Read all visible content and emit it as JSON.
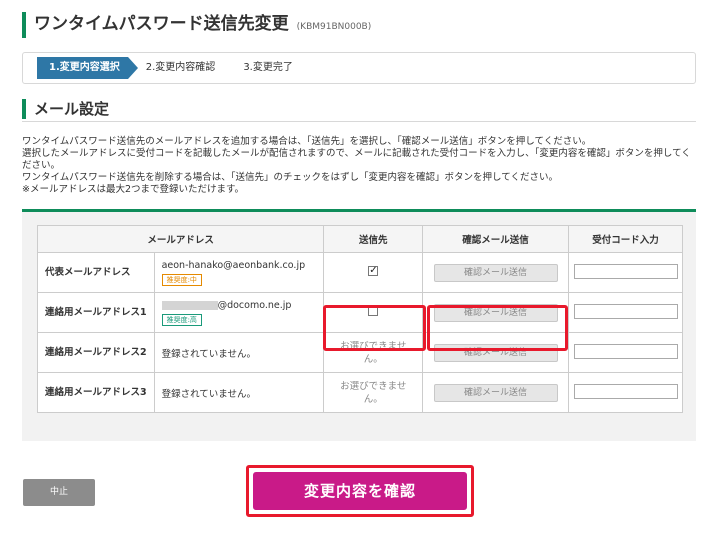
{
  "page": {
    "title": "ワンタイムパスワード送信先変更",
    "code": "(KBM91BN000B)"
  },
  "steps": [
    {
      "label": "1.変更内容選択",
      "active": true
    },
    {
      "label": "2.変更内容確認",
      "active": false
    },
    {
      "label": "3.変更完了",
      "active": false
    }
  ],
  "section": {
    "title": "メール設定"
  },
  "description": {
    "line1": "ワンタイムパスワード送信先のメールアドレスを追加する場合は、「送信先」を選択し、「確認メール送信」ボタンを押してください。",
    "line2": "選択したメールアドレスに受付コードを記載したメールが配信されますので、メールに記載された受付コードを入力し、「変更内容を確認」ボタンを押してく",
    "line3": "ださい。",
    "line4": "ワンタイムパスワード送信先を削除する場合は、「送信先」のチェックをはずし「変更内容を確認」ボタンを押してください。",
    "line5": "※メールアドレスは最大2つまで登録いただけます。"
  },
  "table": {
    "headers": {
      "address": "メールアドレス",
      "sendto": "送信先",
      "confirm": "確認メール送信",
      "code": "受付コード入力"
    },
    "rows": [
      {
        "label": "代表メールアドレス",
        "address": "aeon-hanako@aeonbank.co.jp",
        "badge": "推奨度:中",
        "sendto_state": "checked",
        "confirm_label": "確認メール送信"
      },
      {
        "label": "連絡用メールアドレス1",
        "address_suffix": "@docomo.ne.jp",
        "badge": "推奨度:高",
        "sendto_state": "unchecked",
        "confirm_label": "確認メール送信"
      },
      {
        "label": "連絡用メールアドレス2",
        "address": "登録されていません。",
        "sendto_text": "お選びできません。",
        "confirm_label": "確認メール送信"
      },
      {
        "label": "連絡用メールアドレス3",
        "address": "登録されていません。",
        "sendto_text": "お選びできません。",
        "confirm_label": "確認メール送信"
      }
    ]
  },
  "buttons": {
    "cancel": "中止",
    "submit": "変更内容を確認"
  },
  "colors": {
    "accent_green": "#0e8c5a",
    "step_blue": "#2e77a6",
    "submit_magenta": "#c91a88",
    "highlight_red": "#e8192c"
  }
}
